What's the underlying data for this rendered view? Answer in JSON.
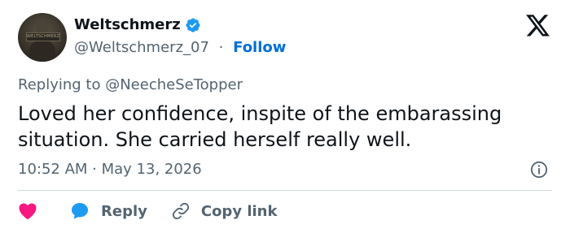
{
  "author": {
    "display_name": "Weltschmerz",
    "handle": "@Weltschmerz_07",
    "separator": "·",
    "follow_label": "Follow",
    "avatar_sign_text": "WELTSCHMERZ"
  },
  "replying_to": "Replying to @NeecheSeTopper",
  "tweet": {
    "text": "Loved her confidence, inspite of the embarassing situation. She carried herself really well."
  },
  "meta": {
    "timestamp": "10:52 AM · May 13, 2026"
  },
  "actions": {
    "reply_label": "Reply",
    "copy_link_label": "Copy link"
  },
  "colors": {
    "heart": "#f91880",
    "reply_bubble": "#1d9bf0",
    "follow": "#006fd6",
    "verified": "#1d9bf0"
  },
  "icons": [
    "verified-badge-icon",
    "x-logo-icon",
    "info-icon",
    "heart-icon",
    "reply-bubble-icon",
    "link-icon"
  ]
}
